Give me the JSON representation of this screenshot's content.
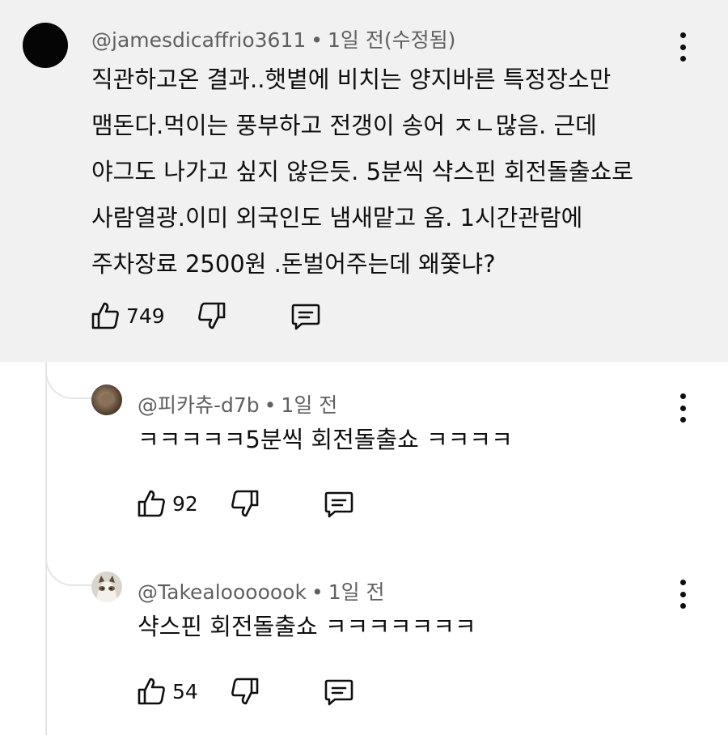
{
  "top_comment": {
    "author": "@jamesdicaffrio3611",
    "time": "1일 전(수정됨)",
    "text_lines": [
      "직관하고온 결과..햇볕에 비치는 양지바른 특정장소만",
      "맴돈다.먹이는 풍부하고 전갱이 송어 ㅈㄴ많음.  근데",
      "야그도 나가고 싶지 않은듯. 5분씩 샥스핀 회전돌출쇼로",
      "사람열광.이미 외국인도 냄새맡고 옴. 1시간관람에",
      "주차장료 2500원 .돈벌어주는데 왜쫓냐?"
    ],
    "likes": "749",
    "colors": {
      "background": "#f1f1f1",
      "avatar": "#050505"
    }
  },
  "replies": [
    {
      "author": "@피카츄-d7b",
      "time": "1일 전",
      "text": "ㅋㅋㅋㅋㅋ5분씩 회전돌출쇼 ㅋㅋㅋㅋ",
      "likes": "92"
    },
    {
      "author": "@Takealooooook",
      "time": "1일 전",
      "text": "샥스핀 회전돌출쇼 ㅋㅋㅋㅋㅋㅋㅋ",
      "likes": "54"
    }
  ],
  "separator": "•",
  "icons": {
    "like": "thumbs-up-icon",
    "dislike": "thumbs-down-icon",
    "reply": "comment-icon",
    "menu": "more-vert-icon"
  }
}
